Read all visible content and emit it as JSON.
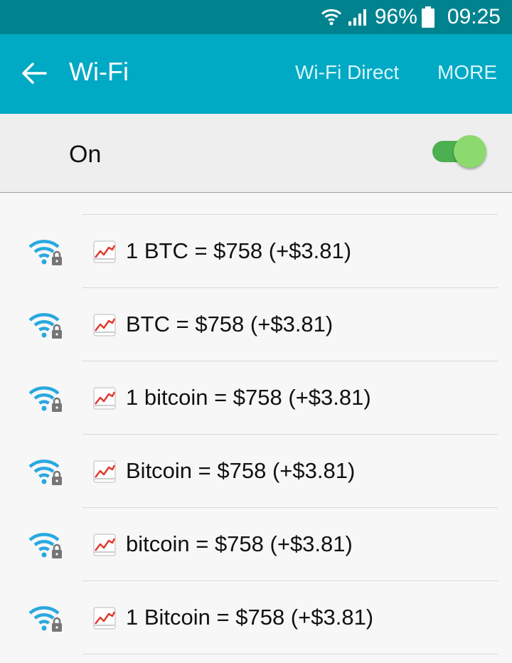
{
  "status_bar": {
    "battery_percent": "96%",
    "time": "09:25",
    "icons": [
      "wifi-signal-icon",
      "cell-signal-icon",
      "battery-icon"
    ]
  },
  "app_bar": {
    "title": "Wi-Fi",
    "actions": {
      "wifi_direct": "Wi-Fi Direct",
      "more": "MORE"
    },
    "back_icon": "arrow-left-icon"
  },
  "toggle": {
    "label": "On",
    "state": "on"
  },
  "networks": [
    {
      "name": "1 BTC = $758 (+$3.81)"
    },
    {
      "name": "BTC = $758 (+$3.81)"
    },
    {
      "name": "1 bitcoin = $758 (+$3.81)"
    },
    {
      "name": "Bitcoin = $758 (+$3.81)"
    },
    {
      "name": "bitcoin = $758 (+$3.81)"
    },
    {
      "name": "1 Bitcoin = $758 (+$3.81)"
    }
  ],
  "colors": {
    "status_bar": "#00838f",
    "app_bar": "#00a9c4",
    "wifi_icon": "#29a8e0",
    "switch_on": "#4caf50"
  }
}
